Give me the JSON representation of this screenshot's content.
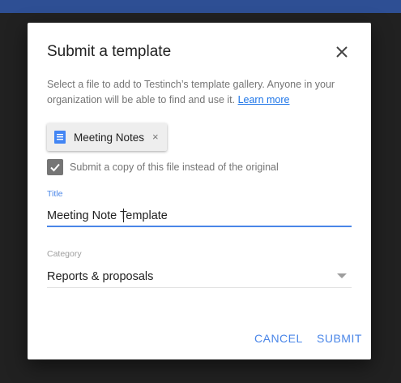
{
  "dialog": {
    "title": "Submit a template",
    "close_icon": "close-icon",
    "description": "Select a file to add to Testinch’s template gallery. Anyone in your organization will be able to find and use it.",
    "learn_more": "Learn more",
    "file_chip": {
      "icon": "document-icon",
      "label": "Meeting Notes",
      "remove": "×"
    },
    "copy_checkbox": {
      "checked": true,
      "label": "Submit a copy of this file instead of the original"
    },
    "title_field": {
      "label": "Title",
      "value": "Meeting Note Template"
    },
    "category_field": {
      "label": "Category",
      "value": "Reports & proposals"
    },
    "actions": {
      "cancel": "CANCEL",
      "submit": "SUBMIT"
    }
  },
  "colors": {
    "accent": "#4a86e8",
    "link": "#1a73e8",
    "backdrop": "#212121",
    "top_bar": "#2e4f94",
    "doc_icon": "#4285f4"
  }
}
